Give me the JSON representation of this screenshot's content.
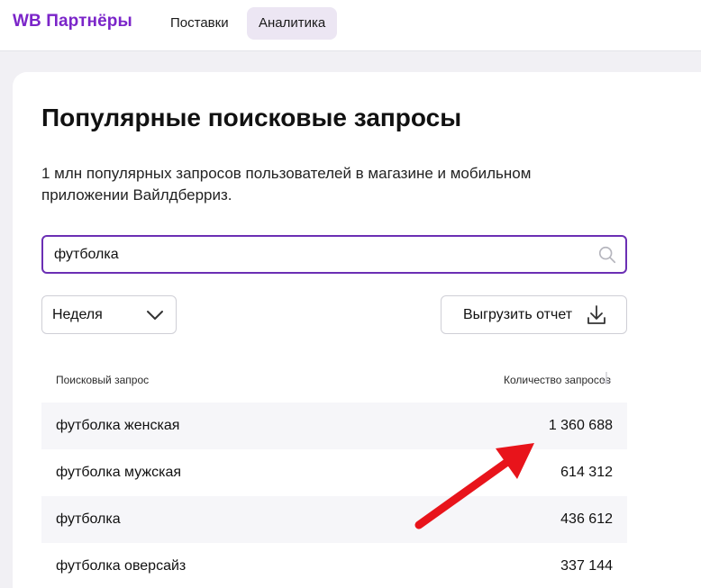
{
  "header": {
    "logo": "WB Партнёры",
    "tabs": [
      {
        "label": "Поставки",
        "active": false
      },
      {
        "label": "Аналитика",
        "active": true
      }
    ]
  },
  "main": {
    "title": "Популярные поисковые запросы",
    "description": "1 млн популярных запросов пользователей в магазине и мобильном приложении Вайлдберриз.",
    "search": {
      "value": "футболка",
      "icon": "search-icon"
    },
    "period_select": {
      "selected": "Неделя",
      "icon": "chevron-down-icon"
    },
    "export_button": {
      "label": "Выгрузить отчет",
      "icon": "download-icon"
    },
    "table": {
      "columns": {
        "query": "Поисковый запрос",
        "count": "Количество запросов",
        "sort": "descending"
      },
      "rows": [
        {
          "query": "футболка женская",
          "count": "1 360 688"
        },
        {
          "query": "футболка мужская",
          "count": "614 312"
        },
        {
          "query": "футболка",
          "count": "436 612"
        },
        {
          "query": "футболка оверсайз",
          "count": "337 144"
        }
      ]
    }
  },
  "colors": {
    "brand": "#7b25c9",
    "active_tab_bg": "#ece6f3",
    "search_border": "#6b2fb4",
    "annotation_arrow": "#e8141b",
    "row_shade": "#f6f6f9"
  }
}
